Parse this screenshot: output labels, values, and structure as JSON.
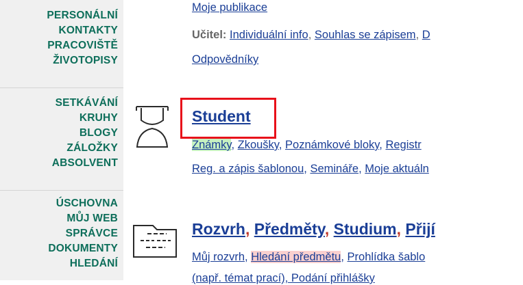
{
  "sidebar": {
    "groups": [
      [
        "PERSONÁLNÍ",
        "KONTAKTY",
        "PRACOVIŠTĚ",
        "ŽIVOTOPISY"
      ],
      [
        "SETKÁVÁNÍ",
        "KRUHY",
        "BLOGY",
        "ZÁLOŽKY",
        "ABSOLVENT"
      ],
      [
        "ÚSCHOVNA",
        "MŮJ WEB",
        "SPRÁVCE",
        "DOKUMENTY",
        "HLEDÁNÍ"
      ]
    ]
  },
  "teacher": {
    "moje_publikace": "Moje publikace",
    "label": "Učitel:",
    "links": [
      "Individuální info",
      "Souhlas se zápisem",
      "D"
    ],
    "odpovedniky": "Odpovědníky"
  },
  "student": {
    "title": "Student",
    "row1": [
      "Známky",
      "Zkoušky",
      "Poznámkové bloky",
      "Registr"
    ],
    "row2": [
      "Reg. a zápis šablonou",
      "Semináře",
      "Moje aktuáln"
    ]
  },
  "rozvrh": {
    "titles": [
      "Rozvrh",
      "Předměty",
      "Studium",
      "Přijí"
    ],
    "row1": [
      "Můj rozvrh",
      "Hledání předmětu",
      "Prohlídka šablo"
    ],
    "row2": "(např. témat prací), Podání přihlášky"
  },
  "icons": [
    "graduate-icon",
    "folder-icon"
  ],
  "colors": {
    "sidebar_text": "#0d6e5a",
    "link": "#1a3e96",
    "highlight_border": "#e8101a"
  }
}
